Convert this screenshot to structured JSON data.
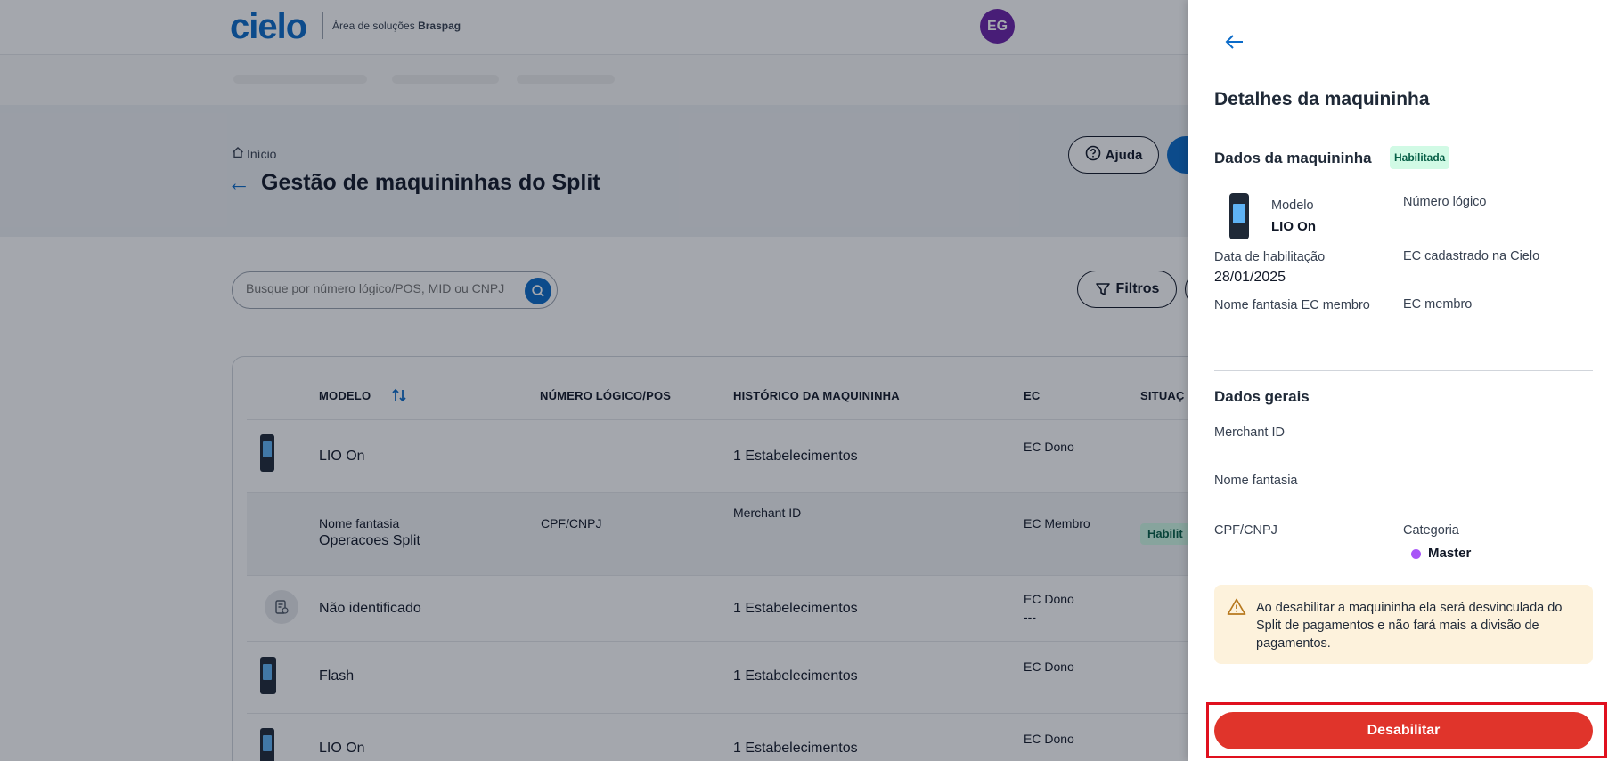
{
  "header": {
    "logo_text": "cielo",
    "subtitle_prefix": "Área de soluções ",
    "subtitle_brand": "Braspag",
    "avatar_initials": "EG"
  },
  "breadcrumb": {
    "home_label": "Início"
  },
  "page": {
    "title": "Gestão de maquininhas do Split",
    "help_label": "Ajuda"
  },
  "search": {
    "placeholder": "Busque por número lógico/POS, MID ou CNPJ"
  },
  "filters": {
    "label": "Filtros"
  },
  "table": {
    "columns": [
      "MODELO",
      "NÚMERO LÓGICO/POS",
      "HISTÓRICO DA MAQUININHA",
      "EC",
      "SITUAÇ"
    ],
    "rows": [
      {
        "model": "LIO On",
        "pos": "",
        "history": "1 Estabelecimentos",
        "ec": "EC Dono",
        "ec_value": ""
      },
      {
        "expanded": true,
        "model_label": "Nome fantasia",
        "model_value": "Operacoes Split",
        "pos": "CPF/CNPJ",
        "history": "Merchant ID",
        "ec": "EC Membro",
        "status": "Habilit"
      },
      {
        "model": "Não identificado",
        "pos": "",
        "history": "1 Estabelecimentos",
        "ec": "EC Dono",
        "ec_value": "---"
      },
      {
        "model": "Flash",
        "pos": "",
        "history": "1 Estabelecimentos",
        "ec": "EC Dono",
        "ec_value": ""
      },
      {
        "model": "LIO On",
        "pos": "",
        "history": "1 Estabelecimentos",
        "ec": "EC Dono",
        "ec_value": ""
      }
    ]
  },
  "drawer": {
    "title": "Detalhes da maquininha",
    "section_device": "Dados da maquininha",
    "status_badge": "Habilitada",
    "model_label": "Modelo",
    "model_value": "LIO On",
    "logical_number_label": "Número lógico",
    "enable_date_label": "Data de habilitação",
    "enable_date_value": "28/01/2025",
    "ec_cielo_label": "EC cadastrado na Cielo",
    "trade_name_member_label": "Nome fantasia EC membro",
    "ec_member_label": "EC membro",
    "section_general": "Dados gerais",
    "merchant_id_label": "Merchant ID",
    "trade_name_label": "Nome fantasia",
    "cpf_cnpj_label": "CPF/CNPJ",
    "category_label": "Categoria",
    "category_value": "Master",
    "warning_text": "Ao desabilitar a maquininha ela será desvinculada do Split de pagamentos e não fará mais a divisão de pagamentos.",
    "disable_button": "Desabilitar"
  },
  "colors": {
    "brand_blue": "#0b6bc9",
    "danger": "#e0342b",
    "badge_green_bg": "#d1fae5",
    "warning_bg": "#fdf2dc",
    "category_dot": "#a855f7",
    "avatar": "#6b21a8"
  }
}
